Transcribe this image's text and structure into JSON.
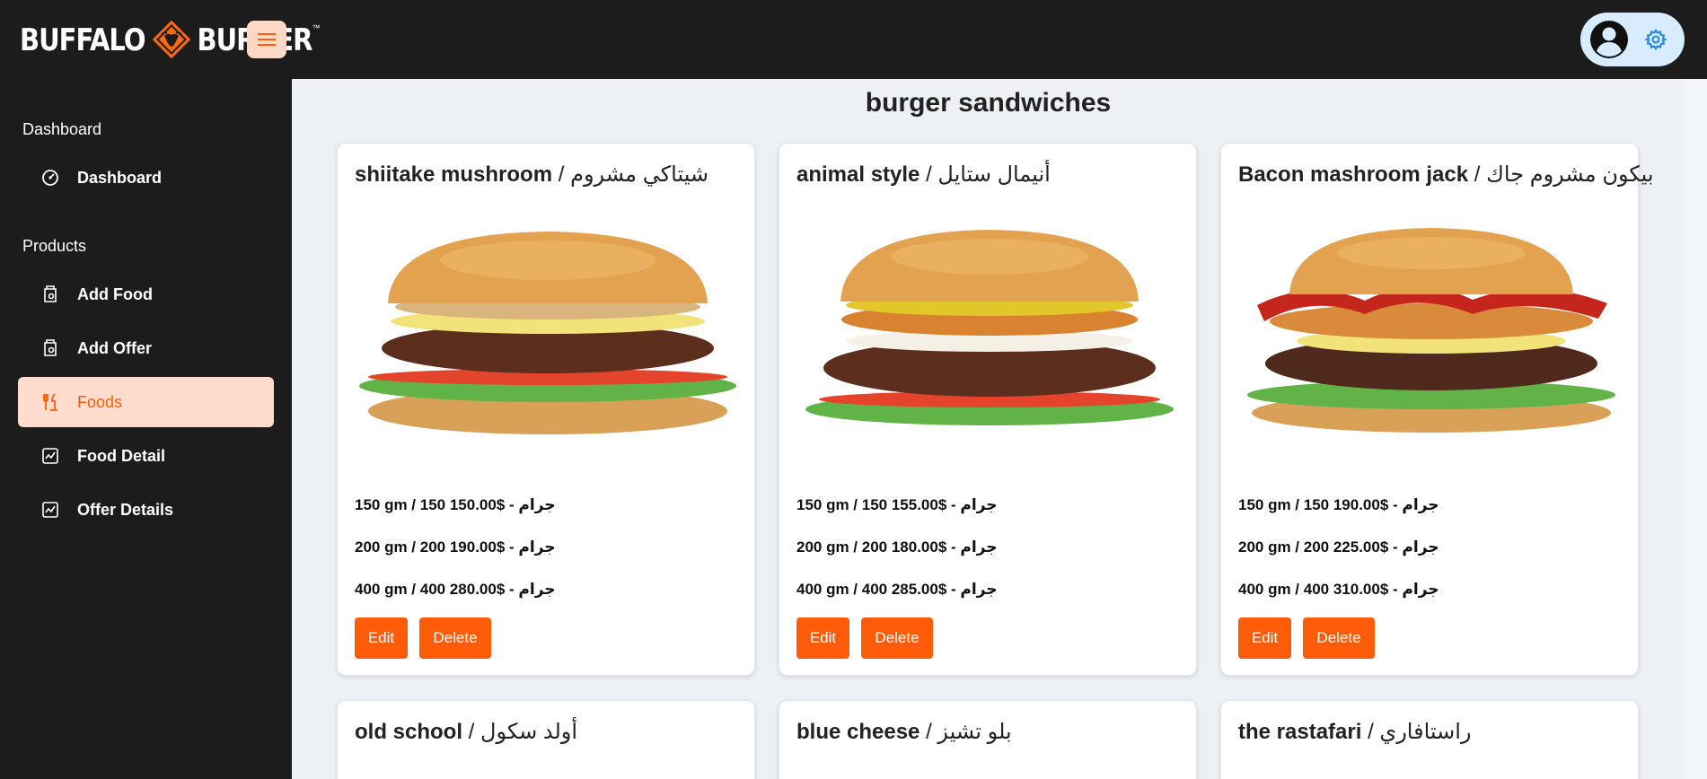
{
  "brand": {
    "word1": "BUFFALO",
    "word2": "BURGER",
    "tm": "™"
  },
  "colors": {
    "accent": "#ff5c0a",
    "accent_light": "#ffdccc",
    "dark": "#1c1c1c",
    "main_bg": "#edf1f6",
    "profile_bg": "#d8ecff",
    "gear": "#2b8ad8"
  },
  "sidebar": {
    "sections": [
      {
        "title": "Dashboard",
        "items": [
          {
            "label": "Dashboard",
            "icon": "gauge-icon"
          }
        ]
      },
      {
        "title": "Products",
        "items": [
          {
            "label": "Add Food",
            "icon": "box-icon"
          },
          {
            "label": "Add Offer",
            "icon": "box-icon"
          },
          {
            "label": "Foods",
            "icon": "utensils-icon",
            "active": true
          },
          {
            "label": "Food Detail",
            "icon": "chart-icon"
          },
          {
            "label": "Offer Details",
            "icon": "chart-icon"
          }
        ]
      }
    ]
  },
  "main": {
    "title": "burger sandwiches",
    "cards": [
      {
        "name_en": "shiitake mushroom",
        "name_ar": "شيتاكي مشروم",
        "prices": [
          "150 gm / 150 150.00$ - جرام",
          "200 gm / 200 190.00$ - جرام",
          "400 gm / 400 280.00$ - جرام"
        ],
        "edit": "Edit",
        "delete": "Delete"
      },
      {
        "name_en": "animal style",
        "name_ar": "أنيمال ستايل",
        "prices": [
          "150 gm / 150 155.00$ - جرام",
          "200 gm / 200 180.00$ - جرام",
          "400 gm / 400 285.00$ - جرام"
        ],
        "edit": "Edit",
        "delete": "Delete"
      },
      {
        "name_en": "Bacon mashroom jack",
        "name_ar": "بيكون مشروم جاك",
        "prices": [
          "150 gm / 150 190.00$ - جرام",
          "200 gm / 200 225.00$ - جرام",
          "400 gm / 400 310.00$ - جرام"
        ],
        "edit": "Edit",
        "delete": "Delete"
      },
      {
        "name_en": "old school",
        "name_ar": "أولد سكول"
      },
      {
        "name_en": "blue cheese",
        "name_ar": "بلو تشيز"
      },
      {
        "name_en": "the rastafari",
        "name_ar": "راستافاري"
      }
    ]
  }
}
